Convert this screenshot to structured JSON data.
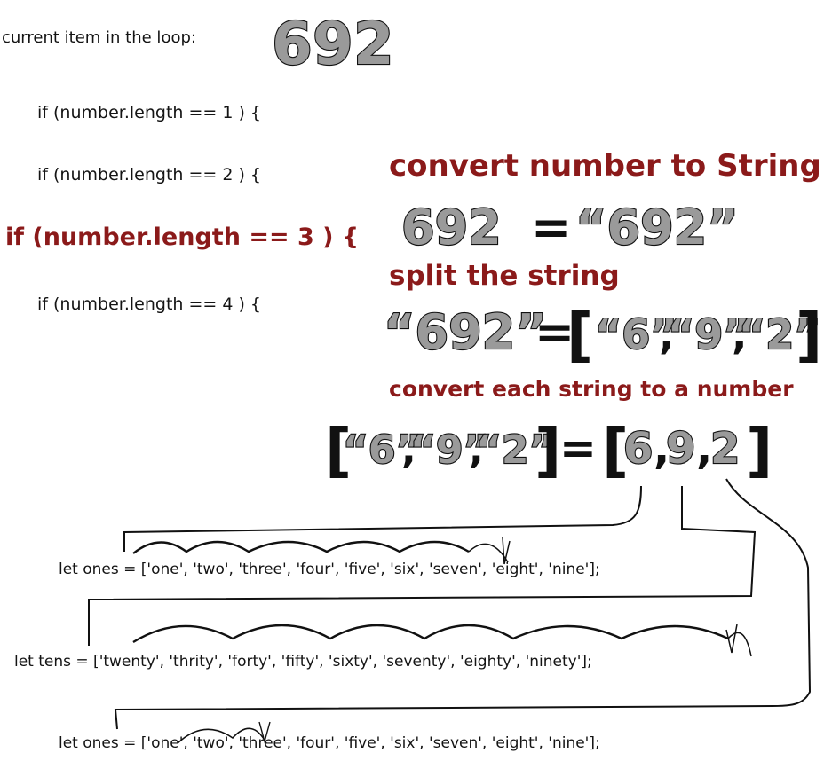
{
  "header": {
    "label": "current item in the loop:",
    "current_number": "692"
  },
  "conditions": [
    "if (number.length == 1 ) {",
    "if (number.length == 2 ) {",
    "if (number.length == 3 ) {",
    "if (number.length == 4 ) {"
  ],
  "active_condition_index": 2,
  "steps": {
    "convert_title": "convert number to String",
    "convert_lhs": "692",
    "convert_eq": "=",
    "convert_rhs": "“692”",
    "split_title": "split the string",
    "split_lhs": "“692”",
    "split_eq": "=",
    "split_items": [
      "“6”",
      "“9”",
      "“2”"
    ],
    "each_title": "convert each string to a number",
    "each_lhs_items": [
      "“6”",
      "“9”",
      "“2”"
    ],
    "each_eq": "=",
    "each_rhs_items": [
      "6",
      "9",
      "2"
    ]
  },
  "arrays": [
    {
      "code": "let ones = ['one', 'two', 'three', 'four', 'five', 'six', 'seven', 'eight', 'nine'];"
    },
    {
      "code": "let tens = ['twenty', 'thrity', 'forty', 'fifty', 'sixty', 'seventy', 'eighty', 'ninety'];"
    },
    {
      "code": "let ones = ['one', 'two', 'three', 'four', 'five', 'six', 'seven', 'eight', 'nine'];"
    }
  ],
  "colors": {
    "highlight": "#8b1a1a",
    "digit_fill": "#9a9a9a",
    "ink": "#111111",
    "background": "#ffffff"
  }
}
